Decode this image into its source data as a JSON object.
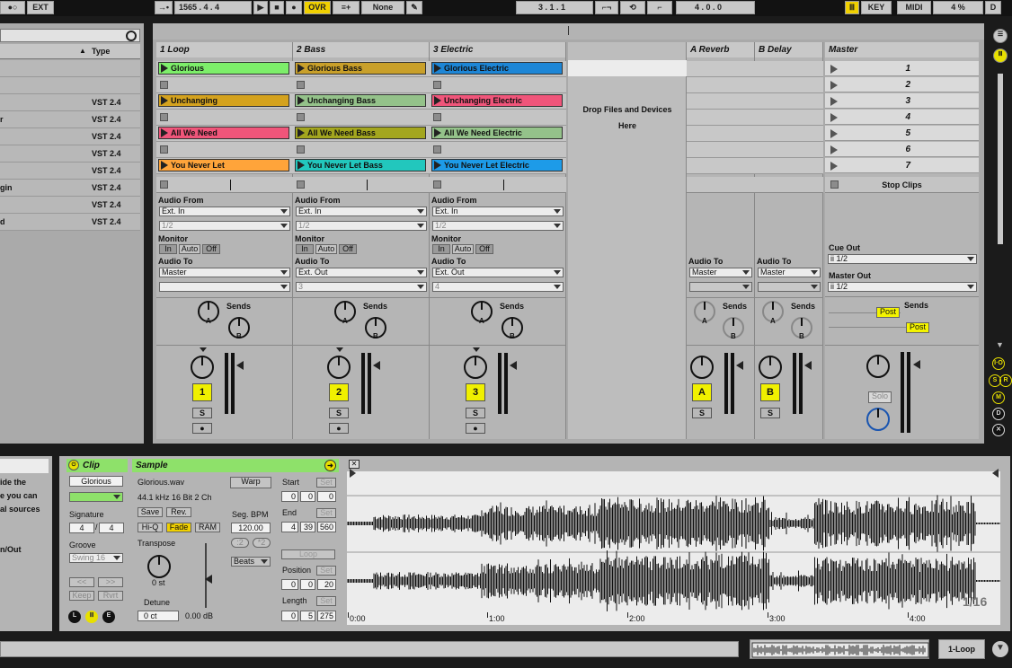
{
  "topbar": {
    "ext_label": "EXT",
    "position": "1565 .  4 .  4",
    "ovr_label": "OVR",
    "quantize": "None",
    "loop_start": "3 .  1 .  1",
    "loop_length": "4 .  0 .  0",
    "key_label": "KEY",
    "midi_label": "MIDI",
    "cpu": "4 %",
    "d_label": "D"
  },
  "browser": {
    "type_header": "Type",
    "rows": [
      {
        "name": "",
        "type": ""
      },
      {
        "name": "",
        "type": ""
      },
      {
        "name": "",
        "type": "VST 2.4"
      },
      {
        "name": "r",
        "type": "VST 2.4"
      },
      {
        "name": "",
        "type": "VST 2.4"
      },
      {
        "name": "",
        "type": "VST 2.4"
      },
      {
        "name": "",
        "type": "VST 2.4"
      },
      {
        "name": "gin",
        "type": "VST 2.4"
      },
      {
        "name": "",
        "type": "VST 2.4"
      },
      {
        "name": "d",
        "type": "VST 2.4"
      }
    ]
  },
  "tracks": [
    {
      "name": "1 Loop",
      "number": "1",
      "clips": [
        {
          "name": "Glorious",
          "color": "#7dee6a"
        },
        {
          "name": "Unchanging",
          "color": "#d4a21e"
        },
        {
          "name": "All We Need",
          "color": "#f0557a"
        },
        {
          "name": "You Never Let",
          "color": "#ffa43a"
        }
      ],
      "audio_from": "Ext. In",
      "channel": "1/2",
      "audio_to": "Master",
      "sub": ""
    },
    {
      "name": "2 Bass",
      "number": "2",
      "clips": [
        {
          "name": "Glorious Bass",
          "color": "#c9a02a"
        },
        {
          "name": "Unchanging Bass",
          "color": "#94c28a"
        },
        {
          "name": "All We Need Bass",
          "color": "#a3a61e"
        },
        {
          "name": "You Never Let Bass",
          "color": "#22c7bd"
        }
      ],
      "audio_from": "Ext. In",
      "channel": "1/2",
      "audio_to": "Ext. Out",
      "sub": "3"
    },
    {
      "name": "3 Electric",
      "number": "3",
      "clips": [
        {
          "name": "Glorious Electric",
          "color": "#1d86d6"
        },
        {
          "name": "Unchanging Electric",
          "color": "#f0557a"
        },
        {
          "name": "All We Need Electric",
          "color": "#94c28a"
        },
        {
          "name": "You Never Let Electric",
          "color": "#1d9be8"
        }
      ],
      "audio_from": "Ext. In",
      "channel": "1/2",
      "audio_to": "Ext. Out",
      "sub": "4"
    }
  ],
  "io": {
    "audio_from": "Audio From",
    "monitor": "Monitor",
    "audio_to": "Audio To",
    "in": "In",
    "auto": "Auto",
    "off": "Off",
    "sends": "Sends",
    "a": "A",
    "b": "B",
    "s": "S"
  },
  "drop": {
    "line1": "Drop Files and Devices",
    "line2": "Here"
  },
  "returns": [
    {
      "name": "A Reverb",
      "letter": "A",
      "audio_to": "Master"
    },
    {
      "name": "B Delay",
      "letter": "B",
      "audio_to": "Master"
    }
  ],
  "master": {
    "name": "Master",
    "scenes": [
      "1",
      "2",
      "3",
      "4",
      "5",
      "6",
      "7"
    ],
    "stop_clips": "Stop Clips",
    "cue_out": "Cue Out",
    "cue_val": "ii 1/2",
    "master_out": "Master Out",
    "master_val": "ii 1/2",
    "post": "Post",
    "solo": "Solo"
  },
  "info": {
    "line1": "ide the",
    "line2": "e you can",
    "line3": "al sources",
    "line4": "n/Out"
  },
  "clip_view": {
    "clip_title": "Clip",
    "clip_name": "Glorious",
    "signature": "Signature",
    "sig_num": "4",
    "sig_den": "4",
    "groove": "Groove",
    "groove_val": "Swing 16",
    "nav_prev": "<<",
    "nav_next": ">>",
    "keep": "Keep",
    "rvrt": "Rvrt",
    "sample_title": "Sample",
    "file": "Glorious.wav",
    "format": "44.1 kHz 16 Bit 2 Ch",
    "save": "Save",
    "rev": "Rev.",
    "hiq": "Hi-Q",
    "fade": "Fade",
    "ram": "RAM",
    "transpose": "Transpose",
    "transpose_val": "0 st",
    "detune": "Detune",
    "detune_val": "0 ct",
    "gain_val": "0.00 dB",
    "warp": "Warp",
    "seg_bpm": "Seg. BPM",
    "bpm_val": "120.00",
    "half": ":2",
    "double": "*2",
    "beats": "Beats",
    "start": "Start",
    "start_vals": [
      "0",
      "0",
      "0"
    ],
    "end": "End",
    "end_vals": [
      "4",
      "39",
      "560"
    ],
    "loop": "Loop",
    "position": "Position",
    "pos_vals": [
      "0",
      "0",
      "20"
    ],
    "length": "Length",
    "len_vals": [
      "0",
      "5",
      "275"
    ],
    "set": "Set",
    "l": "L",
    "e": "E"
  },
  "wave": {
    "ticks": [
      "0:00",
      "1:00",
      "2:00",
      "3:00",
      "4:00"
    ],
    "zoom": "1/16"
  },
  "statusbar": {
    "track": "1-Loop"
  }
}
